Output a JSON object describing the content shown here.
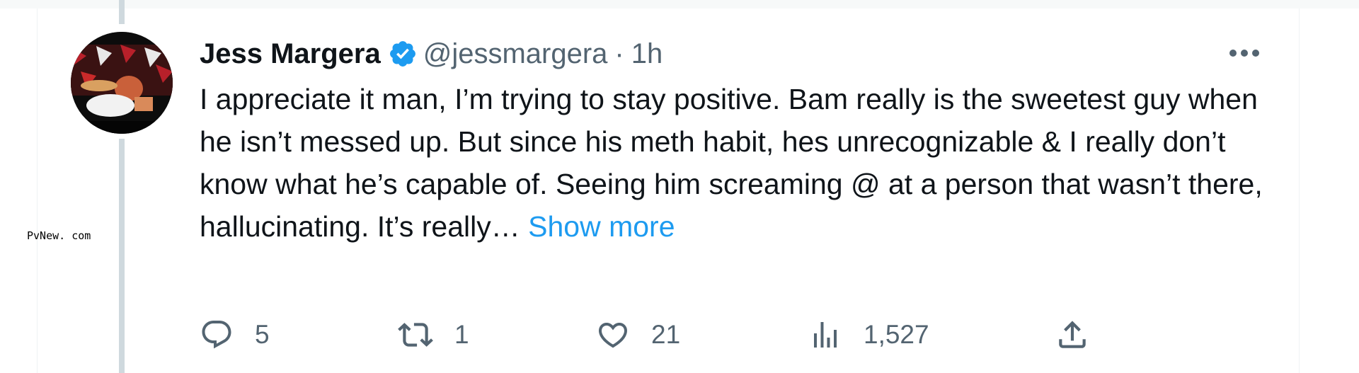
{
  "watermark": "PvNew. com",
  "tweet": {
    "author_name": "Jess Margera",
    "handle": "@jessmargera",
    "separator": "·",
    "time": "1h",
    "text": "I appreciate it man, I’m trying to stay positive. Bam really is the sweetest guy when he isn’t messed up. But since his meth habit, hes unrecognizable & I really don’t know what he’s capable of. Seeing him screaming @ at a person that wasn’t there, hallucinating. It’s really… ",
    "show_more": "Show more",
    "verified_color": "#1d9bf0",
    "link_color": "#1d9bf0"
  },
  "actions": {
    "reply_count": "5",
    "retweet_count": "1",
    "like_count": "21",
    "views_count": "1,527"
  },
  "icons": [
    "reply-icon",
    "retweet-icon",
    "like-icon",
    "views-icon",
    "share-icon",
    "more-icon",
    "verified-badge-icon"
  ]
}
